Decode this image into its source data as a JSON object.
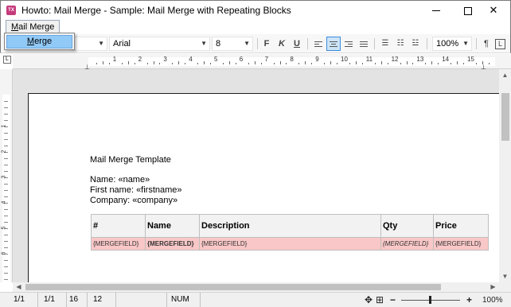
{
  "window": {
    "title": "Howto: Mail Merge - Sample: Mail Merge with Repeating Blocks",
    "app_icon_text": "TX",
    "minimize_label": "",
    "close_label": "✕"
  },
  "menubar": {
    "items": [
      {
        "label": "Mail Merge",
        "underline_char": "M",
        "rest": "ail Merge"
      }
    ]
  },
  "dropdown": {
    "items": [
      {
        "label": "Merge",
        "underline_char": "M",
        "rest": "erge",
        "highlighted": true
      }
    ]
  },
  "toolbar": {
    "style_combo_value": "",
    "font_combo_value": "Arial",
    "size_combo_value": "8",
    "bold_label": "F",
    "italic_label": "K",
    "underline_label": "U",
    "zoom_combo_value": "100%",
    "pilcrow_label": "¶",
    "active_alignment": "center"
  },
  "ruler": {
    "corner_label": "L",
    "numbers": [
      "1",
      "2",
      "3",
      "4",
      "5",
      "6",
      "7",
      "8",
      "9",
      "10",
      "11",
      "12",
      "13",
      "14",
      "15",
      "16"
    ],
    "vertical_numbers": [
      "1",
      "2",
      "3",
      "4",
      "5",
      "6",
      "7"
    ]
  },
  "document": {
    "heading": "Mail Merge Template",
    "lines": [
      "Name: «name»",
      "First name: «firstname»",
      "Company: «company»"
    ],
    "table": {
      "headers": [
        "#",
        "Name",
        "Description",
        "Qty",
        "Price"
      ],
      "row": [
        "{MERGEFIELD}",
        "{MERGEFIELD}",
        "{MERGEFIELD}",
        "{MERGEFIELD}",
        "{MERGEFIELD}"
      ]
    }
  },
  "statusbar": {
    "cells": [
      "1/1",
      "1/1",
      "16",
      "12",
      "",
      "NUM"
    ],
    "zoom_minus": "−",
    "zoom_plus": "+",
    "zoom_value": "100%",
    "zoom_level_fraction": 0.5
  },
  "colors": {
    "merge_row_bg": "#f9c7c7",
    "menu_highlight": "#91c9f7",
    "active_button": "#cce4f7"
  }
}
